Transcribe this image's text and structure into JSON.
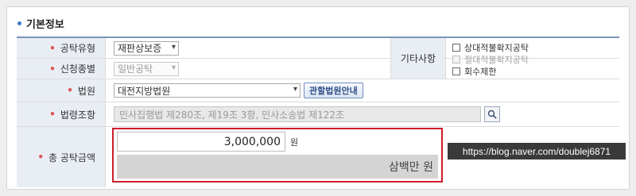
{
  "section": {
    "title": "기본정보"
  },
  "fields": {
    "guarantee_type": {
      "label": "공탁유형",
      "value": "재판상보증"
    },
    "application_type": {
      "label": "신청종별",
      "value": "일반공탁"
    },
    "court": {
      "label": "법원",
      "value": "대전지방법원",
      "guide_button": "관할법원안내"
    },
    "law": {
      "label": "법령조항",
      "value": "민사집행법 제280조, 제19조 3항, 민사소송법 제122조"
    },
    "amount": {
      "label": "총 공탁금액",
      "value": "3,000,000",
      "unit": "원",
      "korean": "삼백만 원"
    }
  },
  "other": {
    "label": "기타사항",
    "options": [
      {
        "label": "상대적불확지공탁",
        "checked": false,
        "disabled": false
      },
      {
        "label": "절대적불확지공탁",
        "checked": false,
        "disabled": true
      },
      {
        "label": "회수제한",
        "checked": false,
        "disabled": false
      }
    ]
  },
  "watermark": "https://blog.naver.com/doublej6871",
  "colors": {
    "highlight_border": "#cc1d2a",
    "label_bg": "#e9edf4",
    "required": "#d9534f",
    "header_line": "#7d93b7"
  },
  "icons": {
    "search": "search-icon",
    "dropdown": "chevron-down-icon"
  }
}
